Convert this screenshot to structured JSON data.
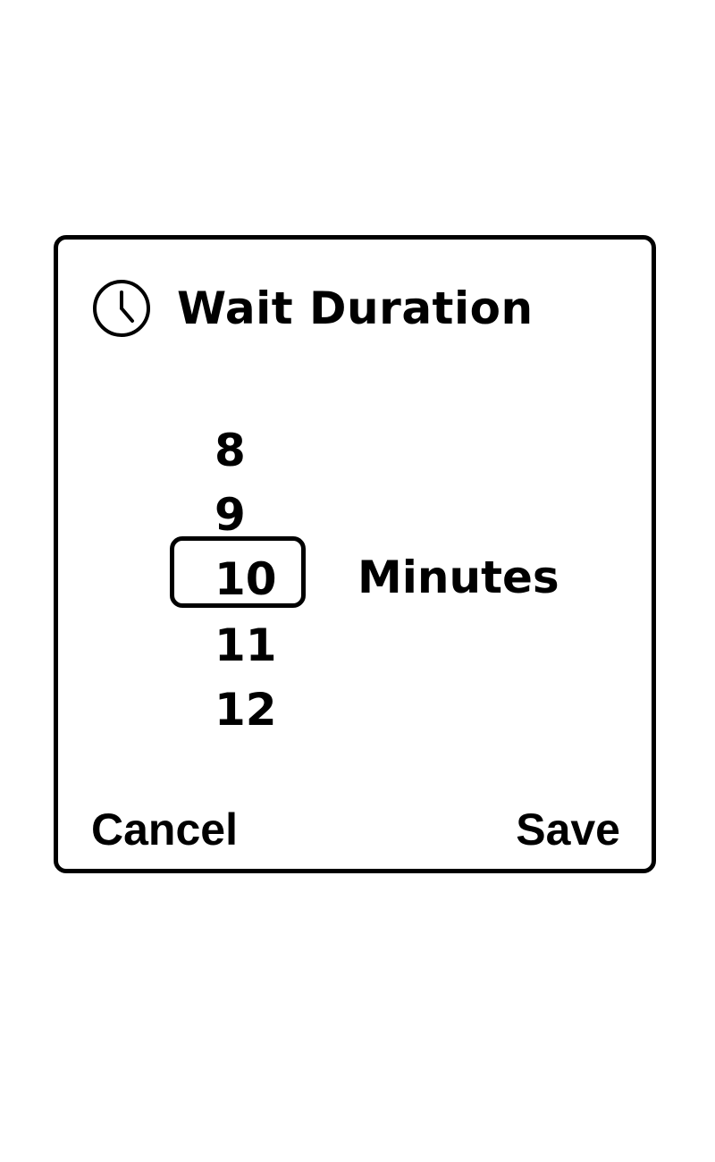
{
  "dialog": {
    "title": "Wait Duration",
    "icon": "clock-icon",
    "picker": {
      "items": [
        "8",
        "9",
        "10",
        "11",
        "12"
      ],
      "selected": "10",
      "unit": "Minutes"
    },
    "actions": {
      "cancel_label": "Cancel",
      "save_label": "Save"
    }
  },
  "colors": {
    "border": "#000000",
    "text": "#000000",
    "background": "#ffffff"
  }
}
